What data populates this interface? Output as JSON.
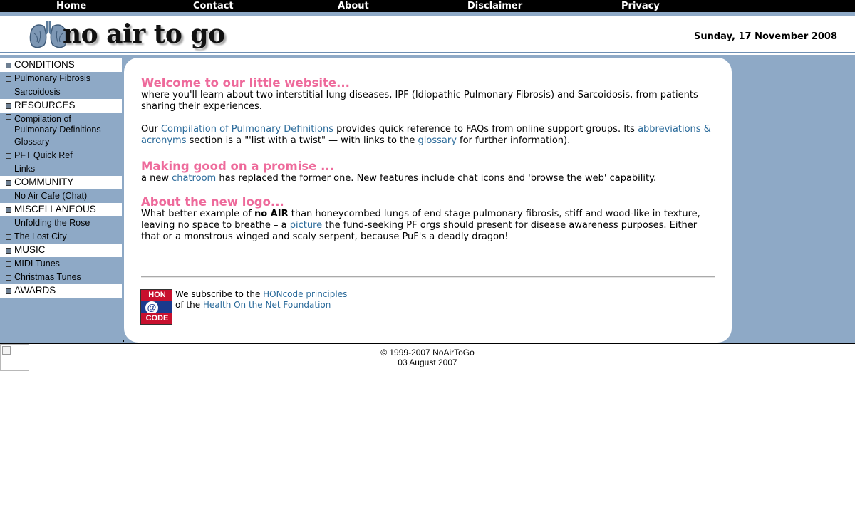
{
  "nav": {
    "items": [
      "Home",
      "Contact",
      "About",
      "Disclaimer",
      "Privacy"
    ]
  },
  "header": {
    "logo_text": "no air to go",
    "date": "Sunday, 17 November 2008"
  },
  "sidebar": {
    "items": [
      {
        "label": "CONDITIONS",
        "type": "section"
      },
      {
        "label": "Pulmonary Fibrosis",
        "type": "link"
      },
      {
        "label": "Sarcoidosis",
        "type": "link"
      },
      {
        "label": "RESOURCES",
        "type": "section"
      },
      {
        "label": "Compilation of Pulmonary Definitions",
        "type": "link"
      },
      {
        "label": "Glossary",
        "type": "link"
      },
      {
        "label": "PFT Quick Ref",
        "type": "link"
      },
      {
        "label": "Links",
        "type": "link"
      },
      {
        "label": "COMMUNITY",
        "type": "section"
      },
      {
        "label": "No Air Cafe (Chat)",
        "type": "link"
      },
      {
        "label": "MISCELLANEOUS",
        "type": "section"
      },
      {
        "label": "Unfolding the Rose",
        "type": "link"
      },
      {
        "label": "The Lost City",
        "type": "link"
      },
      {
        "label": "MUSIC",
        "type": "section"
      },
      {
        "label": "MIDI Tunes",
        "type": "link"
      },
      {
        "label": "Christmas Tunes",
        "type": "link"
      },
      {
        "label": "AWARDS",
        "type": "section"
      }
    ]
  },
  "main": {
    "welcome": {
      "heading": "Welcome to our little website...",
      "intro": "where you'll learn about two interstitial lung diseases, IPF (Idiopathic Pulmonary Fibrosis) and Sarcoidosis, from patients sharing their experiences.",
      "p2_a": "Our ",
      "p2_link1": "Compilation of Pulmonary Definitions",
      "p2_b": " provides quick reference  to FAQs from online support groups. Its ",
      "p2_link2": "abbreviations & acronyms",
      "p2_c": " section is a \"'list with a twist\" — with links to the ",
      "p2_link3": "glossary",
      "p2_d": " for further information)."
    },
    "promise": {
      "heading": "Making good on a promise ...",
      "a": "a new ",
      "link": "chatroom",
      "b": " has replaced the former one. New features include chat icons and 'browse the web' capability."
    },
    "logo": {
      "heading": "About the new logo...",
      "a": "What better example of ",
      "bold": "no AIR",
      "b": " than honeycombed lungs of end stage pulmonary fibrosis,  stiff and wood-like in texture, leaving no space to breathe – a ",
      "link": "picture",
      "c": " the fund-seeking PF orgs should present for disease awareness purposes.  Either that or a monstrous winged and scaly serpent,  because PuF's a deadly dragon!"
    },
    "hon": {
      "badge_top": "HON",
      "badge_at": "@",
      "badge_bottom": "CODE",
      "line1_a": "We subscribe to the ",
      "line1_link": "HONcode principles",
      "line2_a": "of the ",
      "line2_link": "Health On the Net Foundation"
    }
  },
  "footer": {
    "copyright": "© 1999-2007 NoAirToGo",
    "updated": "03 August 2007"
  }
}
